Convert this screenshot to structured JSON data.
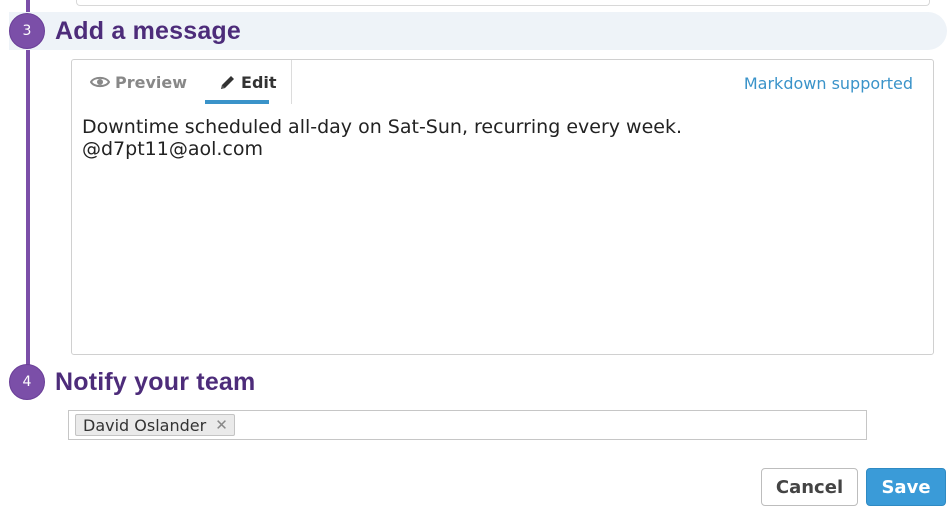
{
  "steps": [
    {
      "number": "3",
      "title": "Add a message"
    },
    {
      "number": "4",
      "title": "Notify your team"
    }
  ],
  "editor": {
    "tabs": {
      "preview": "Preview",
      "edit": "Edit",
      "active": "edit"
    },
    "markdown_link": "Markdown supported",
    "content": "Downtime scheduled all-day on Sat-Sun, recurring every week.\n@d7pt11@aol.com"
  },
  "notify": {
    "tokens": [
      {
        "label": "David Oslander"
      }
    ],
    "remove_glyph": "✕"
  },
  "actions": {
    "cancel": "Cancel",
    "save": "Save"
  },
  "colors": {
    "accent_purple": "#7b4fa8",
    "title_purple": "#4d2c7a",
    "link_blue": "#3a93c9",
    "save_blue": "#3a9bd8"
  },
  "icons": {
    "preview": "eye-icon",
    "edit": "pencil-icon",
    "remove": "close-icon"
  }
}
